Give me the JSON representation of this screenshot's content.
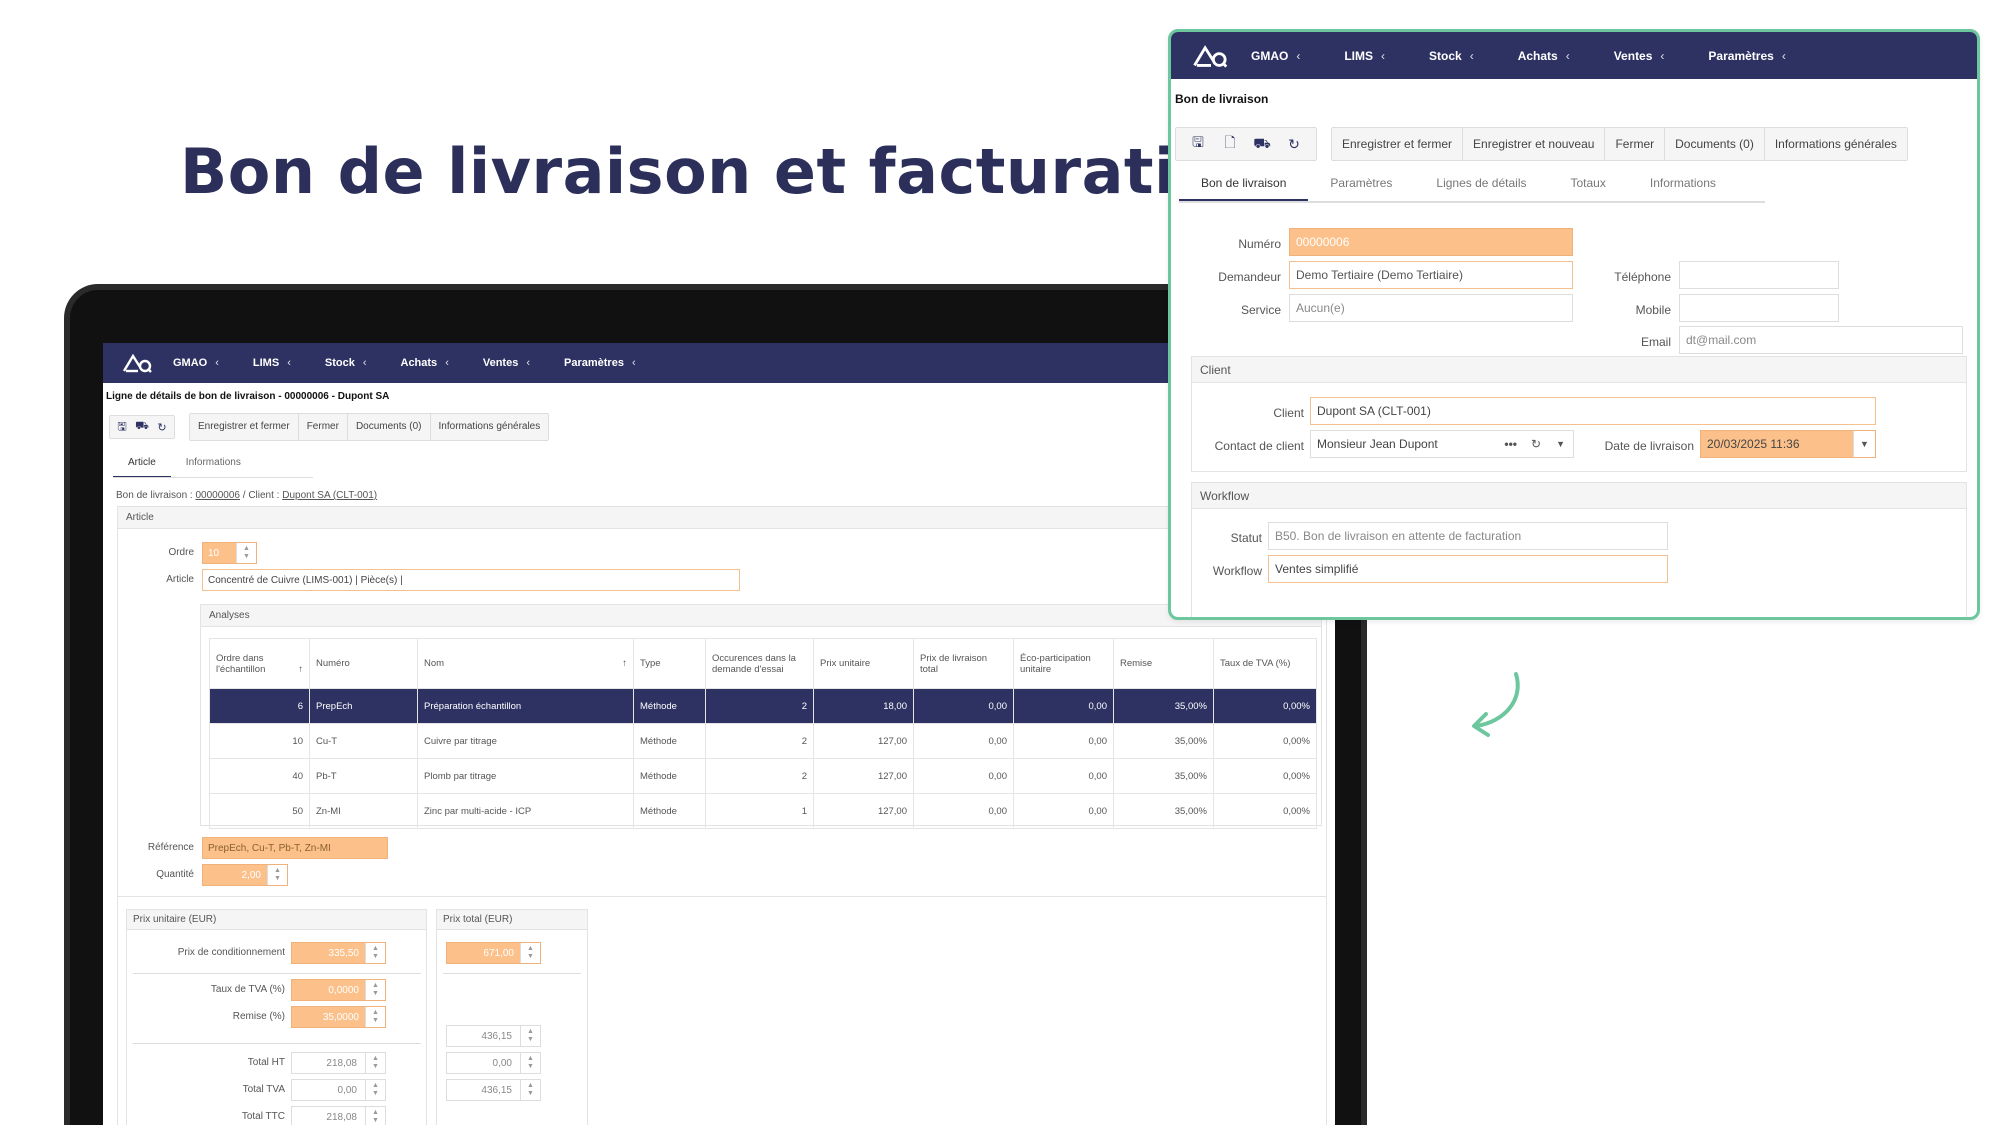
{
  "headline": "Bon de livraison et facturation",
  "nav": {
    "items": [
      {
        "label": "GMAO"
      },
      {
        "label": "LIMS"
      },
      {
        "label": "Stock"
      },
      {
        "label": "Achats"
      },
      {
        "label": "Ventes"
      },
      {
        "label": "Paramètres"
      }
    ],
    "chevron": "‹"
  },
  "detail": {
    "title": "Ligne de détails de bon de livraison - 00000006 - Dupont SA",
    "toolbar": [
      "Enregistrer et fermer",
      "Fermer",
      "Documents (0)",
      "Informations générales"
    ],
    "tabs": [
      "Article",
      "Informations"
    ],
    "breadcrumb": {
      "prefix": "Bon de livraison : ",
      "bl_link": "00000006",
      "sep": " / Client : ",
      "client_link": "Dupont SA (CLT-001)"
    },
    "section": "Article",
    "ordre_label": "Ordre",
    "ordre_value": "10",
    "article_label": "Article",
    "article_value": "Concentré de Cuivre (LIMS-001) | Pièce(s) |",
    "analyses_title": "Analyses",
    "columns": [
      "Ordre dans l'échantillon",
      "Numéro",
      "Nom",
      "Type",
      "Occurences dans la demande d'essai",
      "Prix unitaire",
      "Prix de livraison total",
      "Éco-participation unitaire",
      "Remise",
      "Taux de TVA (%)"
    ],
    "rows": [
      [
        "6",
        "PrepEch",
        "Préparation échantillon",
        "Méthode",
        "2",
        "18,00",
        "0,00",
        "0,00",
        "35,00%",
        "0,00%"
      ],
      [
        "10",
        "Cu-T",
        "Cuivre par titrage",
        "Méthode",
        "2",
        "127,00",
        "0,00",
        "0,00",
        "35,00%",
        "0,00%"
      ],
      [
        "40",
        "Pb-T",
        "Plomb par titrage",
        "Méthode",
        "2",
        "127,00",
        "0,00",
        "0,00",
        "35,00%",
        "0,00%"
      ],
      [
        "50",
        "Zn-MI",
        "Zinc par multi-acide - ICP",
        "Méthode",
        "1",
        "127,00",
        "0,00",
        "0,00",
        "35,00%",
        "0,00%"
      ]
    ],
    "reference_label": "Référence",
    "reference_value": "PrepEch, Cu-T, Pb-T, Zn-MI",
    "quantite_label": "Quantité",
    "quantite_value": "2,00",
    "pu_panel": "Prix unitaire (EUR)",
    "pt_panel": "Prix total (EUR)",
    "prix_cond_label": "Prix de conditionnement",
    "prix_cond_value": "335,50",
    "prix_total_value": "671,00",
    "tva_label": "Taux de TVA (%)",
    "tva_value": "0,0000",
    "remise_label": "Remise (%)",
    "remise_value": "35,0000",
    "total_ht_label": "Total HT",
    "total_ht_value": "218,08",
    "total_tva_label": "Total TVA",
    "total_tva_value": "0,00",
    "total_ttc_label": "Total TTC",
    "total_ttc_value": "218,08",
    "total_ht_total": "436,15",
    "total_tva_total": "0,00",
    "total_ttc_total": "436,15"
  },
  "float": {
    "title": "Bon de livraison",
    "toolbar": [
      "Enregistrer et fermer",
      "Enregistrer et nouveau",
      "Fermer",
      "Documents (0)",
      "Informations générales"
    ],
    "tabs": [
      "Bon de livraison",
      "Paramètres",
      "Lignes de détails",
      "Totaux",
      "Informations"
    ],
    "numero_label": "Numéro",
    "numero_value": "00000006",
    "demandeur_label": "Demandeur",
    "demandeur_value": "Demo Tertiaire (Demo Tertiaire)",
    "service_label": "Service",
    "service_value": "Aucun(e)",
    "telephone_label": "Téléphone",
    "mobile_label": "Mobile",
    "email_label": "Email",
    "email_value": "dt@mail.com",
    "client_section": "Client",
    "client_label": "Client",
    "client_value": "Dupont SA (CLT-001)",
    "contact_label": "Contact de client",
    "contact_value": "Monsieur Jean Dupont",
    "date_label": "Date de livraison",
    "date_value": "20/03/2025 11:36",
    "workflow_section": "Workflow",
    "statut_label": "Statut",
    "statut_value": "B50. Bon de livraison en attente de facturation",
    "workflow_label": "Workflow",
    "workflow_value": "Ventes simplifié"
  },
  "colors": {
    "nav": "#2e3262",
    "accent_orange": "#fcc18a",
    "frame_green": "#6cc79e",
    "headline": "#2b2f5a"
  }
}
